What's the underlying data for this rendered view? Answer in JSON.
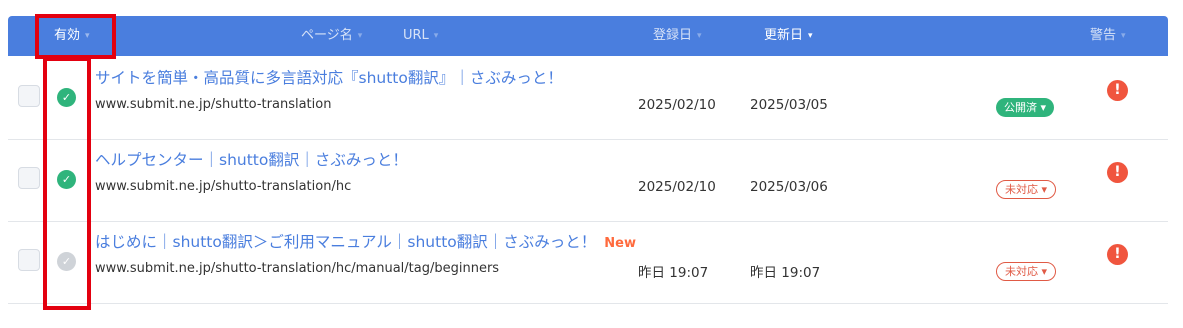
{
  "header": {
    "active_label": "有効",
    "page_name_label": "ページ名",
    "url_label": "URL",
    "registered_label": "登録日",
    "updated_label": "更新日",
    "warning_label": "警告",
    "sort_caret": "▾"
  },
  "rows": [
    {
      "title": "サイトを簡単・高品質に多言語対応『shutto翻訳』｜さぶみっと！",
      "new_label": "",
      "url": "www.submit.ne.jp/shutto-translation",
      "registered": "2025/02/10",
      "updated": "2025/03/05",
      "status": "公開済 ▾",
      "status_check": "✓",
      "warning": "!"
    },
    {
      "title": "ヘルプセンター｜shutto翻訳｜さぶみっと！",
      "new_label": "",
      "url": "www.submit.ne.jp/shutto-translation/hc",
      "registered": "2025/02/10",
      "updated": "2025/03/06",
      "status": "未対応 ▾",
      "status_check": "✓",
      "warning": "!"
    },
    {
      "title": "はじめに｜shutto翻訳＞ご利用マニュアル｜shutto翻訳｜さぶみっと！",
      "new_label": "New",
      "url": "www.submit.ne.jp/shutto-translation/hc/manual/tag/beginners",
      "registered": "昨日 19:07",
      "updated": "昨日 19:07",
      "status": "未対応 ▾",
      "status_check": "✓",
      "warning": "!"
    }
  ],
  "colors": {
    "header_bg": "#4a7ede",
    "active_green": "#2fb47c",
    "warning_red": "#f0553e",
    "highlight_red": "#e3000f"
  },
  "icons": [
    "check-circle-icon",
    "warning-icon",
    "sort-caret-icon"
  ]
}
